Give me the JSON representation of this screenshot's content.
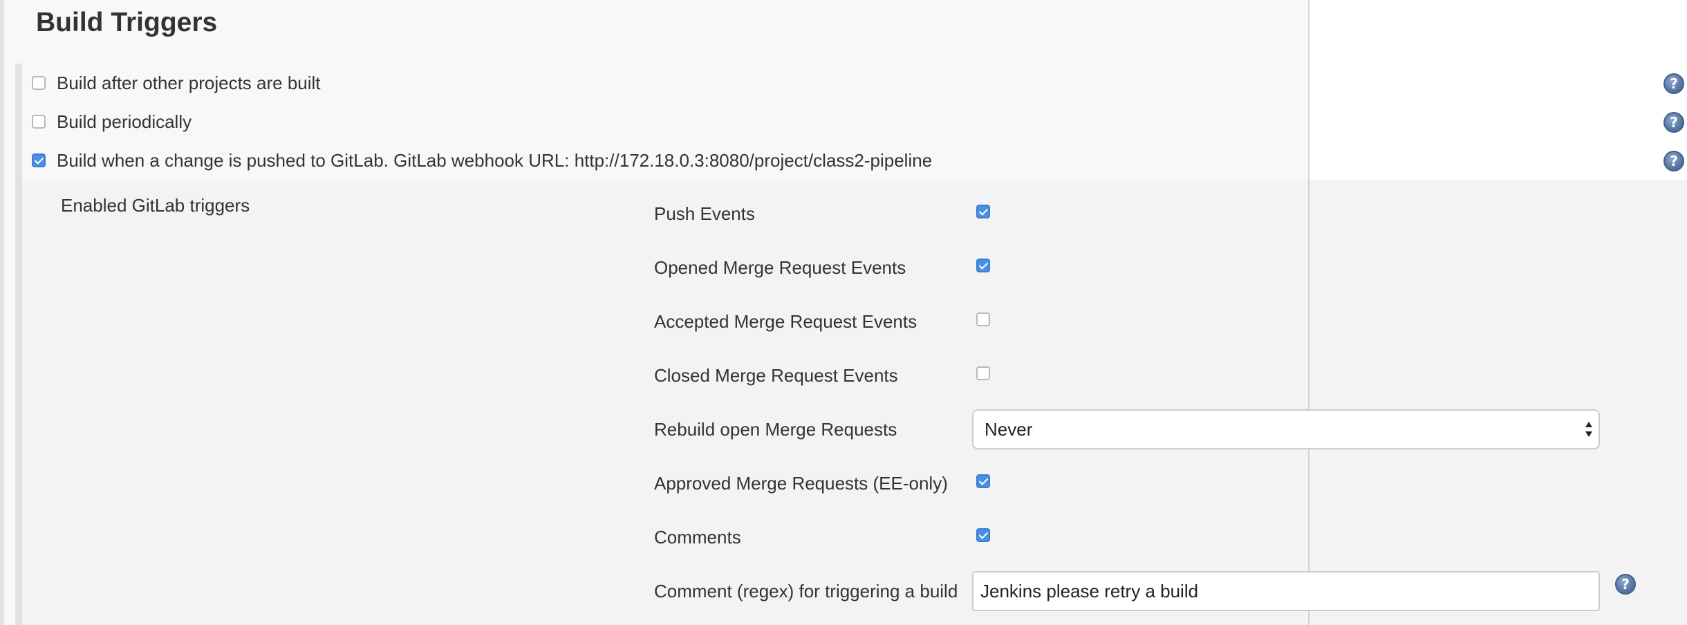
{
  "section": {
    "title": "Build Triggers"
  },
  "triggers": [
    {
      "label": "Build after other projects are built",
      "checked": false,
      "help_icon": "help-icon"
    },
    {
      "label": "Build periodically",
      "checked": false,
      "help_icon": "help-icon"
    },
    {
      "label": "Build when a change is pushed to GitLab. GitLab webhook URL: http://172.18.0.3:8080/project/class2-pipeline",
      "checked": true,
      "help_icon": "help-icon"
    }
  ],
  "gitlab": {
    "enabled_label": "Enabled GitLab triggers",
    "push_events": {
      "label": "Push Events",
      "checked": true
    },
    "opened_mr_events": {
      "label": "Opened Merge Request Events",
      "checked": true
    },
    "accepted_mr_events": {
      "label": "Accepted Merge Request Events",
      "checked": false
    },
    "closed_mr_events": {
      "label": "Closed Merge Request Events",
      "checked": false
    },
    "rebuild_open_mr": {
      "label": "Rebuild open Merge Requests",
      "value": "Never"
    },
    "approved_mr": {
      "label": "Approved Merge Requests (EE-only)",
      "checked": true
    },
    "comments": {
      "label": "Comments",
      "checked": true
    },
    "comment_regex": {
      "label": "Comment (regex) for triggering a build",
      "value": "Jenkins please retry a build",
      "help_icon": "help-icon"
    }
  },
  "colors": {
    "checkbox_checked": "#4a90e2",
    "help_icon": "#5c7aa8",
    "panel_bg": "#f3f3f3"
  }
}
